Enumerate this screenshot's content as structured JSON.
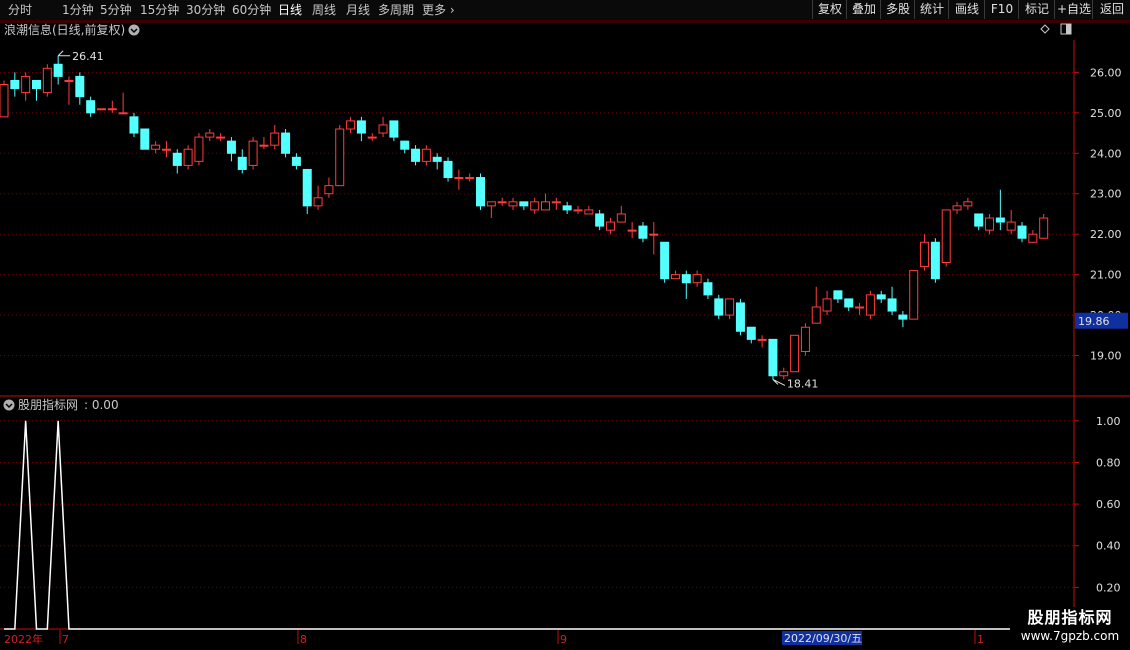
{
  "toolbar": {
    "periods": [
      "分时",
      "1分钟",
      "5分钟",
      "15分钟",
      "30分钟",
      "60分钟",
      "日线",
      "周线",
      "月线",
      "多周期",
      "更多"
    ],
    "active_period": "日线",
    "buttons": [
      "复权",
      "叠加",
      "多股",
      "统计",
      "画线",
      "F10",
      "标记",
      "+自选",
      "返回"
    ]
  },
  "main_panel": {
    "title": "浪潮信息(日线,前复权)",
    "high_label": "26.41",
    "low_label": "18.41",
    "current_price": "19.86",
    "y_ticks": [
      "26.00",
      "25.00",
      "24.00",
      "23.00",
      "22.00",
      "21.00",
      "20.00",
      "19.00"
    ]
  },
  "indicator_panel": {
    "title": "股朋指标网",
    "value_text": ": 0.00",
    "y_ticks": [
      "1.00",
      "0.80",
      "0.60",
      "0.40",
      "0.20"
    ]
  },
  "date_axis": {
    "year_label": "2022年",
    "month_labels": [
      "7",
      "8",
      "9",
      "1"
    ],
    "cursor_date": "2022/09/30/五"
  },
  "watermark": {
    "name": "股朋指标网",
    "url": "www.7gpzb.com"
  },
  "colors": {
    "up": "#ff3c3c",
    "down": "#54ffff",
    "axis": "#c01010",
    "grid": "#7a0000",
    "price_tag_bg": "#1030a0"
  },
  "chart_data": {
    "type": "candlestick",
    "candles": [
      [
        24.9,
        25.7,
        25.8,
        24.9
      ],
      [
        25.8,
        25.6,
        26.0,
        25.4
      ],
      [
        25.5,
        25.9,
        26.0,
        25.3
      ],
      [
        25.8,
        25.6,
        25.8,
        25.3
      ],
      [
        25.5,
        26.1,
        26.2,
        25.4
      ],
      [
        26.2,
        25.9,
        26.41,
        25.7
      ],
      [
        25.8,
        25.8,
        25.9,
        25.2
      ],
      [
        25.9,
        25.4,
        26.0,
        25.2
      ],
      [
        25.3,
        25.0,
        25.4,
        24.9
      ],
      [
        25.1,
        25.1,
        25.1,
        25.1
      ],
      [
        25.1,
        25.1,
        25.3,
        25.0
      ],
      [
        25.0,
        25.0,
        25.5,
        25.0
      ],
      [
        24.9,
        24.5,
        25.0,
        24.4
      ],
      [
        24.6,
        24.1,
        24.6,
        24.1
      ],
      [
        24.1,
        24.2,
        24.3,
        24.0
      ],
      [
        24.1,
        24.1,
        24.3,
        23.9
      ],
      [
        24.0,
        23.7,
        24.1,
        23.5
      ],
      [
        23.7,
        24.1,
        24.2,
        23.6
      ],
      [
        23.8,
        24.4,
        24.5,
        23.7
      ],
      [
        24.4,
        24.5,
        24.6,
        24.3
      ],
      [
        24.4,
        24.4,
        24.5,
        24.3
      ],
      [
        24.3,
        24.0,
        24.4,
        23.8
      ],
      [
        23.9,
        23.6,
        24.1,
        23.5
      ],
      [
        23.7,
        24.3,
        24.4,
        23.6
      ],
      [
        24.2,
        24.2,
        24.4,
        24.1
      ],
      [
        24.2,
        24.5,
        24.7,
        24.1
      ],
      [
        24.5,
        24.0,
        24.6,
        23.9
      ],
      [
        23.9,
        23.7,
        24.0,
        23.6
      ],
      [
        23.6,
        22.7,
        23.6,
        22.5
      ],
      [
        22.7,
        22.9,
        23.2,
        22.6
      ],
      [
        23.0,
        23.2,
        23.4,
        22.9
      ],
      [
        23.2,
        24.6,
        24.7,
        23.2
      ],
      [
        24.6,
        24.8,
        24.9,
        24.5
      ],
      [
        24.8,
        24.5,
        24.9,
        24.3
      ],
      [
        24.4,
        24.4,
        24.5,
        24.3
      ],
      [
        24.5,
        24.7,
        24.9,
        24.4
      ],
      [
        24.8,
        24.4,
        24.8,
        24.3
      ],
      [
        24.3,
        24.1,
        24.3,
        24.0
      ],
      [
        24.1,
        23.8,
        24.2,
        23.7
      ],
      [
        23.8,
        24.1,
        24.2,
        23.7
      ],
      [
        23.9,
        23.8,
        24.0,
        23.6
      ],
      [
        23.8,
        23.4,
        23.9,
        23.3
      ],
      [
        23.4,
        23.4,
        23.6,
        23.1
      ],
      [
        23.4,
        23.4,
        23.5,
        23.3
      ],
      [
        23.4,
        22.7,
        23.5,
        22.6
      ],
      [
        22.7,
        22.8,
        22.8,
        22.4
      ],
      [
        22.8,
        22.8,
        22.9,
        22.7
      ],
      [
        22.7,
        22.8,
        22.9,
        22.6
      ],
      [
        22.8,
        22.7,
        22.8,
        22.6
      ],
      [
        22.6,
        22.8,
        22.9,
        22.5
      ],
      [
        22.6,
        22.8,
        23.0,
        22.6
      ],
      [
        22.8,
        22.8,
        22.9,
        22.6
      ],
      [
        22.7,
        22.6,
        22.8,
        22.5
      ],
      [
        22.6,
        22.6,
        22.7,
        22.5
      ],
      [
        22.5,
        22.6,
        22.7,
        22.5
      ],
      [
        22.5,
        22.2,
        22.6,
        22.1
      ],
      [
        22.1,
        22.3,
        22.4,
        22.0
      ],
      [
        22.3,
        22.5,
        22.7,
        22.3
      ],
      [
        22.1,
        22.1,
        22.3,
        21.9
      ],
      [
        22.2,
        21.9,
        22.3,
        21.8
      ],
      [
        22.0,
        22.0,
        22.3,
        21.5
      ],
      [
        21.8,
        20.9,
        21.8,
        20.8
      ],
      [
        20.9,
        21.0,
        21.1,
        20.9
      ],
      [
        21.0,
        20.8,
        21.1,
        20.4
      ],
      [
        20.8,
        21.0,
        21.1,
        20.7
      ],
      [
        20.8,
        20.5,
        20.9,
        20.4
      ],
      [
        20.4,
        20.0,
        20.5,
        19.9
      ],
      [
        20.0,
        20.4,
        20.4,
        19.9
      ],
      [
        20.3,
        19.6,
        20.4,
        19.5
      ],
      [
        19.7,
        19.4,
        19.7,
        19.3
      ],
      [
        19.4,
        19.4,
        19.5,
        19.2
      ],
      [
        19.4,
        18.5,
        19.4,
        18.41
      ],
      [
        18.5,
        18.6,
        18.7,
        18.41
      ],
      [
        18.6,
        19.5,
        19.5,
        18.6
      ],
      [
        19.1,
        19.7,
        19.8,
        19.0
      ],
      [
        19.8,
        20.2,
        20.7,
        19.8
      ],
      [
        20.1,
        20.4,
        20.6,
        20.0
      ],
      [
        20.6,
        20.4,
        20.6,
        20.3
      ],
      [
        20.4,
        20.2,
        20.4,
        20.1
      ],
      [
        20.2,
        20.2,
        20.3,
        20.0
      ],
      [
        20.0,
        20.5,
        20.6,
        19.9
      ],
      [
        20.5,
        20.4,
        20.6,
        20.3
      ],
      [
        20.4,
        20.1,
        20.7,
        20.0
      ],
      [
        20.0,
        19.9,
        20.1,
        19.7
      ],
      [
        19.9,
        21.1,
        21.1,
        19.9
      ],
      [
        21.2,
        21.8,
        22.0,
        21.1
      ],
      [
        21.8,
        20.9,
        21.9,
        20.8
      ],
      [
        21.3,
        22.6,
        22.6,
        21.2
      ],
      [
        22.6,
        22.7,
        22.8,
        22.5
      ],
      [
        22.7,
        22.8,
        22.9,
        22.6
      ],
      [
        22.5,
        22.2,
        22.5,
        22.1
      ],
      [
        22.1,
        22.4,
        22.5,
        22.0
      ],
      [
        22.4,
        22.3,
        23.1,
        22.1
      ],
      [
        22.1,
        22.3,
        22.6,
        22.0
      ],
      [
        22.2,
        21.9,
        22.3,
        21.8
      ],
      [
        21.8,
        22.0,
        22.1,
        21.8
      ],
      [
        21.9,
        22.4,
        22.5,
        21.9
      ]
    ],
    "indicator_values": [
      0,
      0,
      1,
      0,
      0,
      1,
      0,
      0,
      0,
      0,
      0,
      0,
      0,
      0,
      0,
      0,
      0,
      0,
      0,
      0,
      0,
      0,
      0,
      0,
      0,
      0,
      0,
      0,
      0,
      0,
      0,
      0,
      0,
      0,
      0,
      0,
      0,
      0,
      0,
      0,
      0,
      0,
      0,
      0,
      0,
      0,
      0,
      0,
      0,
      0,
      0,
      0,
      0,
      0,
      0,
      0,
      0,
      0,
      0,
      0,
      0,
      0,
      0,
      0,
      0,
      0,
      0,
      0,
      0,
      0,
      0,
      0,
      0,
      0,
      0,
      0,
      0,
      0,
      0,
      0,
      0,
      0,
      0,
      0,
      0,
      0,
      0,
      0,
      0,
      0,
      0,
      0,
      0,
      0,
      0,
      0,
      0
    ],
    "main_ylim": [
      18.0,
      26.8
    ],
    "indicator_ylim": [
      0.0,
      1.1
    ]
  }
}
